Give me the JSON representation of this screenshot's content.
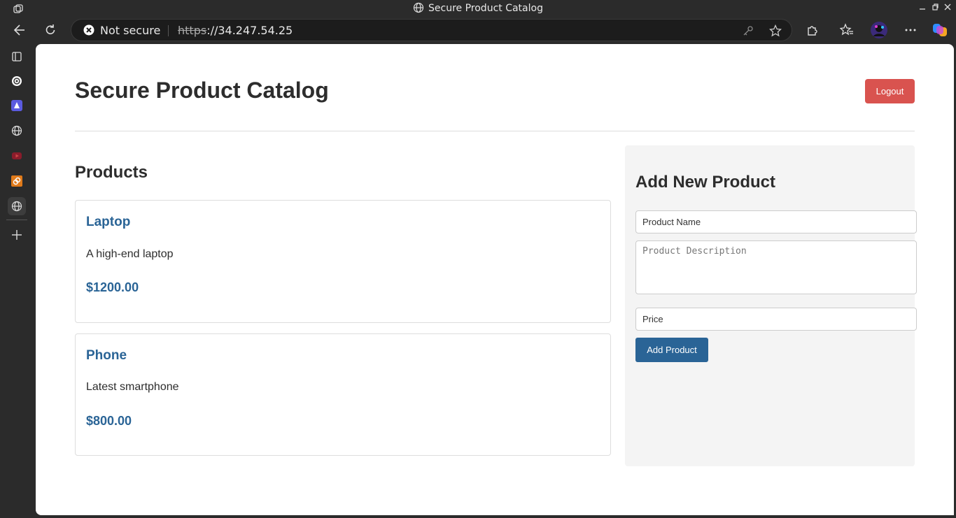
{
  "window": {
    "title": "Secure Product Catalog"
  },
  "addressbar": {
    "security_label": "Not secure",
    "url_scheme": "https",
    "url_rest": "://34.247.54.25"
  },
  "page": {
    "title": "Secure Product Catalog",
    "logout_label": "Logout",
    "products_heading": "Products",
    "products": [
      {
        "name": "Laptop",
        "description": "A high-end laptop",
        "price": "$1200.00"
      },
      {
        "name": "Phone",
        "description": "Latest smartphone",
        "price": "$800.00"
      }
    ],
    "form": {
      "heading": "Add New Product",
      "name_placeholder": "Product Name",
      "description_placeholder": "Product Description",
      "price_placeholder": "Price",
      "submit_label": "Add Product"
    }
  },
  "colors": {
    "accent": "#2a6496",
    "danger": "#d9534f",
    "panel": "#f4f4f4"
  },
  "icons": {
    "sidebar": [
      "tabs-icon",
      "chatgpt-icon",
      "app-icon",
      "globe-icon",
      "youtube-icon",
      "orange-app-icon",
      "globe-icon",
      "add-icon"
    ],
    "toolbar": [
      "back-icon",
      "refresh-icon",
      "password-key-icon",
      "favorite-star-icon",
      "extensions-icon",
      "favorites-icon",
      "profile-avatar",
      "more-icon",
      "copilot-icon"
    ]
  }
}
